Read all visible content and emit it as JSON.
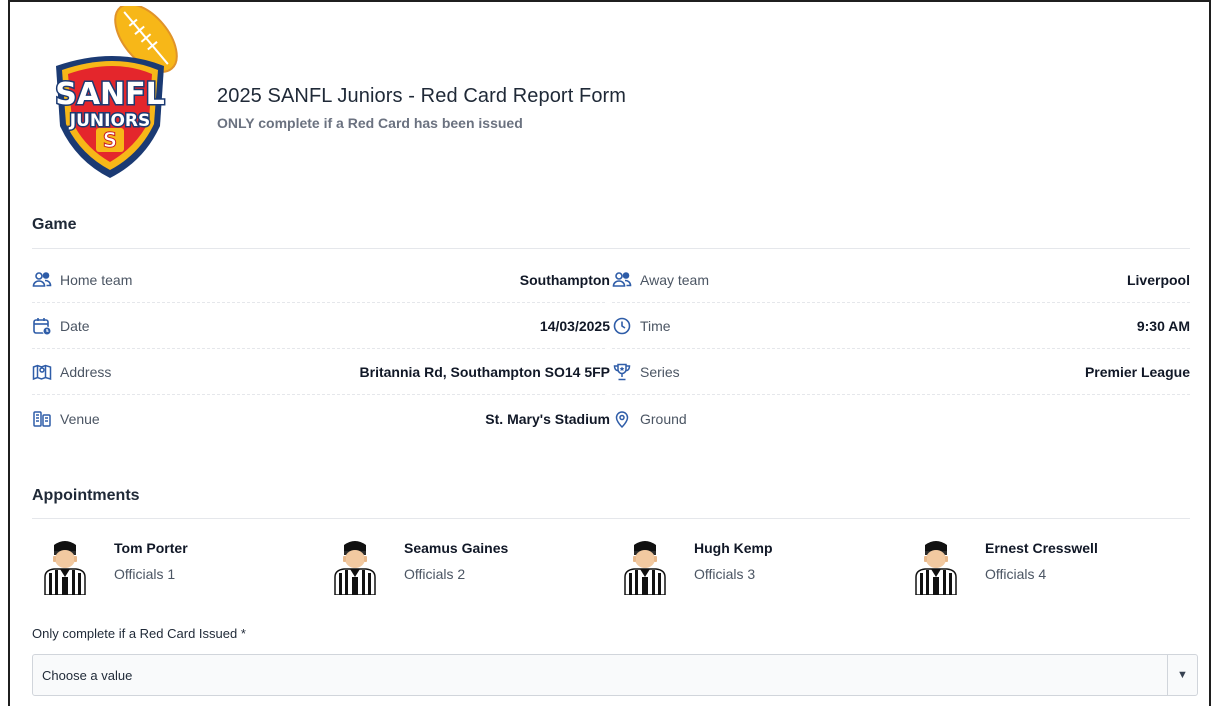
{
  "header": {
    "logo_text_top": "SANFL",
    "logo_text_bottom": "JUNIORS",
    "logo_letter": "S",
    "title": "2025 SANFL Juniors - Red Card Report Form",
    "subtitle": "ONLY complete if a Red Card has been issued"
  },
  "game": {
    "section_title": "Game",
    "rows": [
      {
        "left": {
          "icon": "users-icon",
          "label": "Home team",
          "value": "Southampton"
        },
        "right": {
          "icon": "users-icon",
          "label": "Away team",
          "value": "Liverpool"
        }
      },
      {
        "left": {
          "icon": "calendar-clock-icon",
          "label": "Date",
          "value": "14/03/2025"
        },
        "right": {
          "icon": "clock-icon",
          "label": "Time",
          "value": "9:30 AM"
        }
      },
      {
        "left": {
          "icon": "map-pin-icon",
          "label": "Address",
          "value": "Britannia Rd, Southampton SO14 5FP"
        },
        "right": {
          "icon": "trophy-icon",
          "label": "Series",
          "value": "Premier League"
        }
      },
      {
        "left": {
          "icon": "building-icon",
          "label": "Venue",
          "value": "St. Mary's Stadium"
        },
        "right": {
          "icon": "location-pin-icon",
          "label": "Ground",
          "value": ""
        }
      }
    ]
  },
  "appointments": {
    "section_title": "Appointments",
    "officials": [
      {
        "name": "Tom Porter",
        "role": "Officials 1"
      },
      {
        "name": "Seamus Gaines",
        "role": "Officials 2"
      },
      {
        "name": "Hugh Kemp",
        "role": "Officials 3"
      },
      {
        "name": "Ernest Cresswell",
        "role": "Officials 4"
      }
    ]
  },
  "form": {
    "red_card_label": "Only complete if a Red Card Issued *",
    "red_card_value": "Choose a value",
    "dropdown_icon": "caret-down-icon"
  },
  "colors": {
    "icon_blue": "#2f5da8",
    "logo_red": "#e4262c",
    "logo_navy": "#1b3a73",
    "logo_yellow": "#f7b718"
  }
}
